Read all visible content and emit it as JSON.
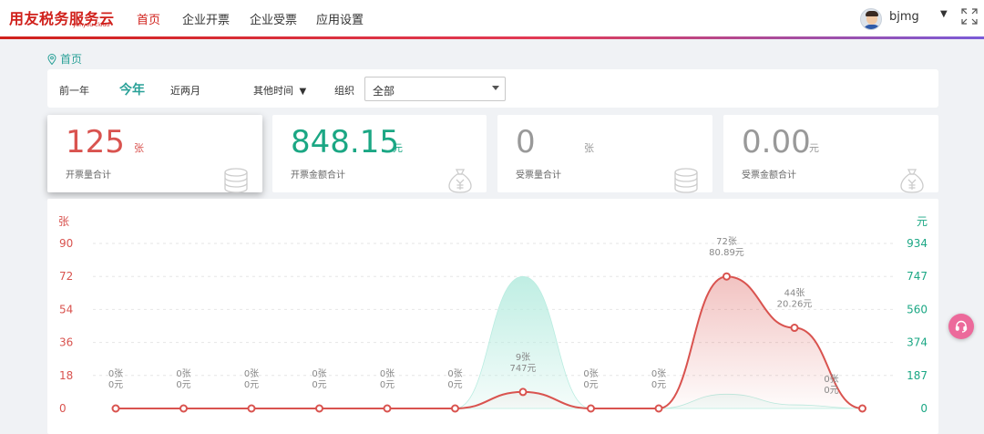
{
  "app": {
    "logo_text": "用友税务服务云",
    "logo_sub": "yonyou cloud",
    "brand_color": "#d0211c",
    "accent_color": "#2aa198"
  },
  "nav": {
    "items": [
      {
        "label": "首页",
        "active": true
      },
      {
        "label": "企业开票",
        "active": false
      },
      {
        "label": "企业受票",
        "active": false
      },
      {
        "label": "应用设置",
        "active": false
      }
    ]
  },
  "user": {
    "name": "bjmg",
    "avatar_icon": "user-avatar",
    "menu_icon": "caret-down-icon",
    "fullscreen_icon": "fullscreen-icon"
  },
  "breadcrumb": {
    "icon": "location-pin-icon",
    "label": "首页"
  },
  "filter": {
    "periods": [
      {
        "label": "前一年",
        "active": false
      },
      {
        "label": "今年",
        "active": true
      },
      {
        "label": "近两月",
        "active": false
      }
    ],
    "other_time_label": "其他时间",
    "org_label": "组织",
    "org_value": "全部"
  },
  "cards": [
    {
      "value": "125",
      "unit": "张",
      "label": "开票量合计",
      "icon": "coin-stack-icon",
      "color": "#d9534f",
      "selected": true
    },
    {
      "value": "848.15",
      "unit": "元",
      "label": "开票金额合计",
      "icon": "money-bag-icon",
      "color": "#1ba784",
      "selected": false
    },
    {
      "value": "0",
      "unit": "张",
      "label": "受票量合计",
      "icon": "coin-stack-icon",
      "color": "#999999",
      "selected": false
    },
    {
      "value": "0.00",
      "unit": "元",
      "label": "受票金额合计",
      "icon": "money-bag-icon",
      "color": "#999999",
      "selected": false
    }
  ],
  "help_icon": "headset-icon",
  "chart_data": {
    "type": "line",
    "y_left_label": "张",
    "y_right_label": "元",
    "y_left_ticks": [
      "90",
      "72",
      "54",
      "36",
      "18",
      "0"
    ],
    "y_right_ticks": [
      "934",
      "747",
      "560",
      "374",
      "187",
      "0"
    ],
    "ylim_left": [
      0,
      90
    ],
    "ylim_right": [
      0,
      934
    ],
    "grid": true,
    "series": [
      {
        "color": "#d9534f",
        "axis": "left",
        "values": [
          0,
          0,
          0,
          0,
          0,
          0,
          9,
          0,
          0,
          72,
          44,
          0
        ]
      },
      {
        "color": "#b8ece0",
        "axis": "right",
        "values": [
          0,
          0,
          0,
          0,
          0,
          0,
          747,
          0,
          0,
          80.89,
          20.26,
          0
        ]
      }
    ],
    "point_labels": [
      {
        "count": "0张",
        "amount": "0元"
      },
      {
        "count": "0张",
        "amount": "0元"
      },
      {
        "count": "0张",
        "amount": "0元"
      },
      {
        "count": "0张",
        "amount": "0元"
      },
      {
        "count": "0张",
        "amount": "0元"
      },
      {
        "count": "0张",
        "amount": "0元"
      },
      {
        "count": "9张",
        "amount": "747元"
      },
      {
        "count": "0张",
        "amount": "0元"
      },
      {
        "count": "0张",
        "amount": "0元"
      },
      {
        "count": "72张",
        "amount": "80.89元"
      },
      {
        "count": "44张",
        "amount": "20.26元"
      },
      {
        "count": "0张",
        "amount": "0元"
      }
    ]
  }
}
